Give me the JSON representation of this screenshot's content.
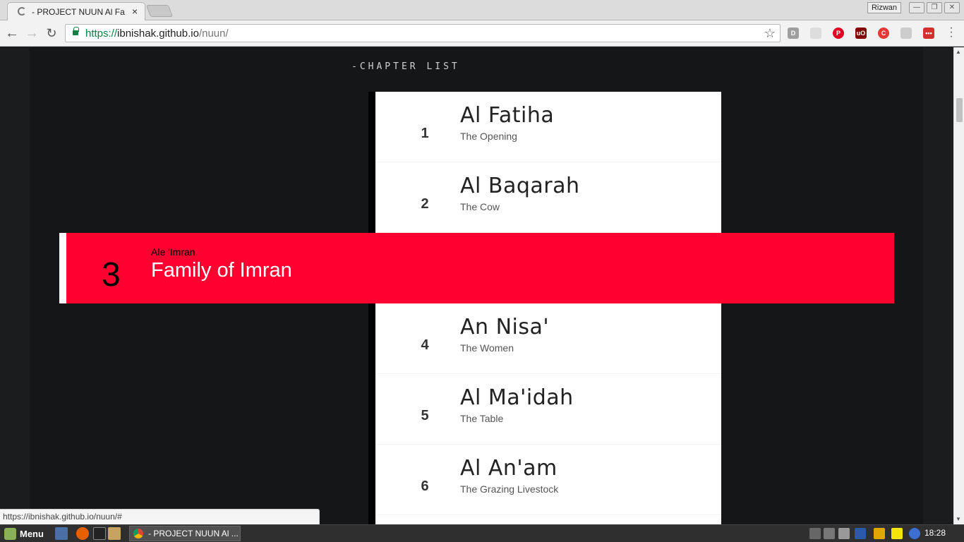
{
  "browser": {
    "tab_title": "- PROJECT NUUN Al Fatiha",
    "tab_close": "×",
    "profile_name": "Rizwan",
    "url_scheme": "https://",
    "url_host": "ibnishak.github.io",
    "url_path": "/nuun/",
    "status_url": "https://ibnishak.github.io/nuun/#"
  },
  "page": {
    "heading": "-CHAPTER LIST",
    "chapters": [
      {
        "number": "1",
        "name": "Al Fatiha",
        "translation": "The Opening"
      },
      {
        "number": "2",
        "name": "Al Baqarah",
        "translation": "The Cow"
      },
      {
        "number": "4",
        "name": "An Nisa'",
        "translation": "The Women"
      },
      {
        "number": "5",
        "name": "Al Ma'idah",
        "translation": "The Table"
      },
      {
        "number": "6",
        "name": "Al An'am",
        "translation": "The Grazing Livestock"
      }
    ],
    "active_chapter": {
      "number": "3",
      "name": "Ale 'Imran",
      "translation": "Family of Imran"
    }
  },
  "taskbar": {
    "menu_label": "Menu",
    "task_title": "- PROJECT NUUN Al ...",
    "clock": "18:28"
  },
  "colors": {
    "highlight": "#ff0030",
    "page_bg": "#151618",
    "url_green": "#0b8043"
  }
}
